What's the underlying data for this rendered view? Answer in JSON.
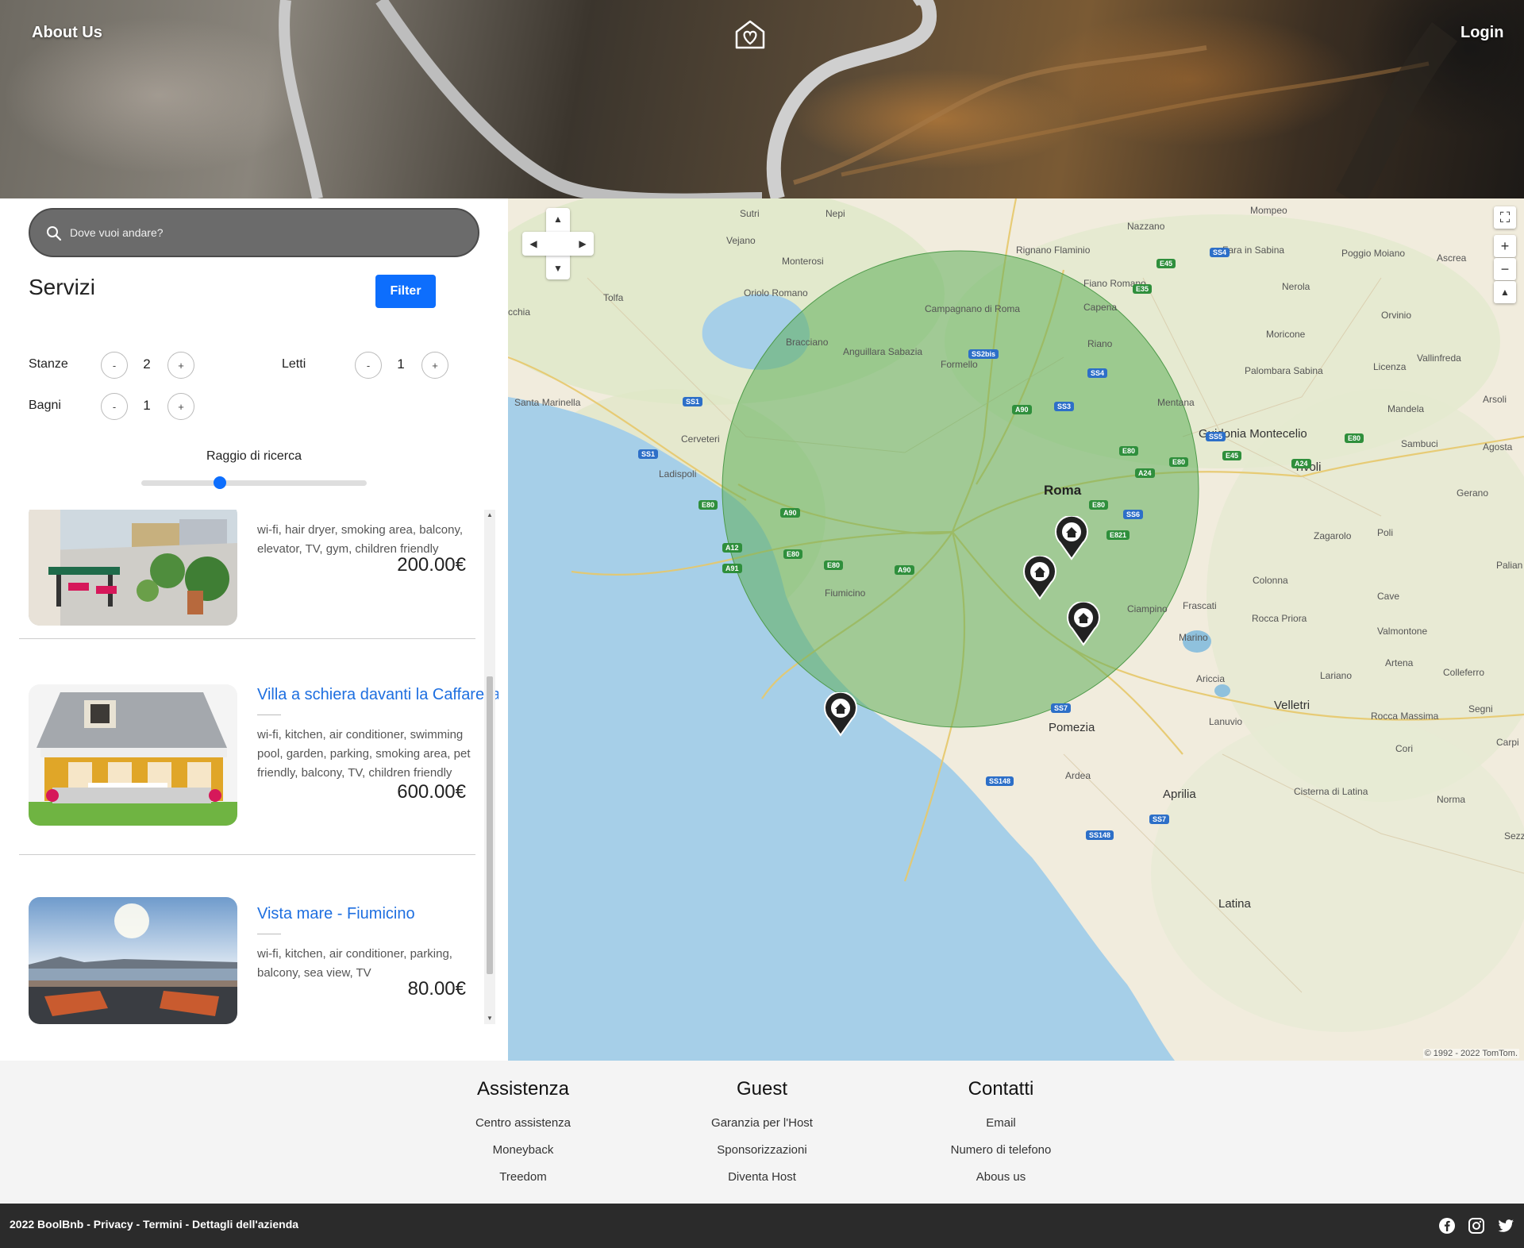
{
  "header": {
    "about_label": "About Us",
    "login_label": "Login"
  },
  "search": {
    "placeholder": "Dove vuoi andare?"
  },
  "filters": {
    "title": "Servizi",
    "filter_label": "Filter",
    "rooms_label": "Stanze",
    "rooms_value": "2",
    "beds_label": "Letti",
    "beds_value": "1",
    "baths_label": "Bagni",
    "baths_value": "1",
    "minus": "-",
    "plus": "+",
    "radius_label": "Raggio di ricerca",
    "radius_fraction": 0.34
  },
  "listings": [
    {
      "title": "",
      "services": "wi-fi, hair dryer, smoking area, balcony, elevator, TV, gym, children friendly",
      "price": "200.00€"
    },
    {
      "title": "Villa a schiera davanti la Caffarella",
      "services": "wi-fi, kitchen, air conditioner, swimming pool, garden, parking, smoking area, pet friendly, balcony, TV, children friendly",
      "price": "600.00€"
    },
    {
      "title": "Vista mare - Fiumicino",
      "services": "wi-fi, kitchen, air conditioner, parking, balcony, sea view, TV",
      "price": "80.00€"
    }
  ],
  "map": {
    "places": [
      "Sutri",
      "Nepi",
      "Mompeo",
      "Nazzano",
      "Vejano",
      "Rignano Flaminio",
      "Fara in Sabina",
      "Poggio Moiano",
      "Ascrea",
      "Monterosi",
      "Fiano Romano",
      "Nerola",
      "Tolfa",
      "Oriolo Romano",
      "Campagnano di Roma",
      "Capena",
      "Orvinio",
      "Moricone",
      "Vallinfreda",
      "Bracciano",
      "Anguillara Sabazia",
      "Riano",
      "Palombara Sabina",
      "Licenza",
      "Formello",
      "Mentana",
      "Mandela",
      "Arsoli",
      "Santa Marinella",
      "Guidonia Montecelio",
      "Cerveteri",
      "Sambuci",
      "Agosta",
      "Ladispoli",
      "Tivoli",
      "Gerano",
      "Poli",
      "Zagarolo",
      "Colonna",
      "Cave",
      "Ciampino",
      "Frascati",
      "Rocca Priora",
      "Valmontone",
      "Marino",
      "Ariccia",
      "Artena",
      "Lariano",
      "Colleferro",
      "Velletri",
      "Lanuvio",
      "Pomezia",
      "Rocca Massima",
      "Segni",
      "Cori",
      "Ardea",
      "Aprilia",
      "Cisterna di Latina",
      "Norma",
      "Latina",
      "Roma",
      "Fiumicino",
      "cchia",
      "Palian",
      "Carpi",
      "Sezz"
    ],
    "roads": [
      "E45",
      "SS4",
      "E35",
      "SS2bis",
      "SS4",
      "A90",
      "SS3",
      "SS1",
      "SS5",
      "E80",
      "E45",
      "A24",
      "E80",
      "E80",
      "A24",
      "SS1",
      "E80",
      "A90",
      "E80",
      "SS6",
      "E821",
      "A12",
      "A91",
      "E80",
      "E80",
      "A90",
      "SS7",
      "SS148",
      "SS7",
      "SS148"
    ],
    "copyright": "© 1992 - 2022 TomTom."
  },
  "footer": {
    "columns": [
      {
        "title": "Assistenza",
        "links": [
          "Centro assistenza",
          "Moneyback",
          "Treedom"
        ]
      },
      {
        "title": "Guest",
        "links": [
          "Garanzia per l'Host",
          "Sponsorizzazioni",
          "Diventa Host"
        ]
      },
      {
        "title": "Contatti",
        "links": [
          "Email",
          "Numero di telefono",
          "Abous us"
        ]
      }
    ],
    "bottom_text": "2022 BoolBnb - Privacy - Termini - Dettagli dell'azienda"
  },
  "colors": {
    "accent": "#0d6efd",
    "link": "#1e6fe0",
    "radius_circle": "#5fae5a",
    "sea": "#a6cfe8",
    "footer_dark": "#2b2b2b"
  },
  "icons": [
    "search-icon",
    "home-heart-logo-icon",
    "facebook-icon",
    "instagram-icon",
    "twitter-icon",
    "map-pin-icon",
    "fullscreen-icon",
    "zoom-in-icon",
    "zoom-out-icon",
    "compass-icon"
  ]
}
